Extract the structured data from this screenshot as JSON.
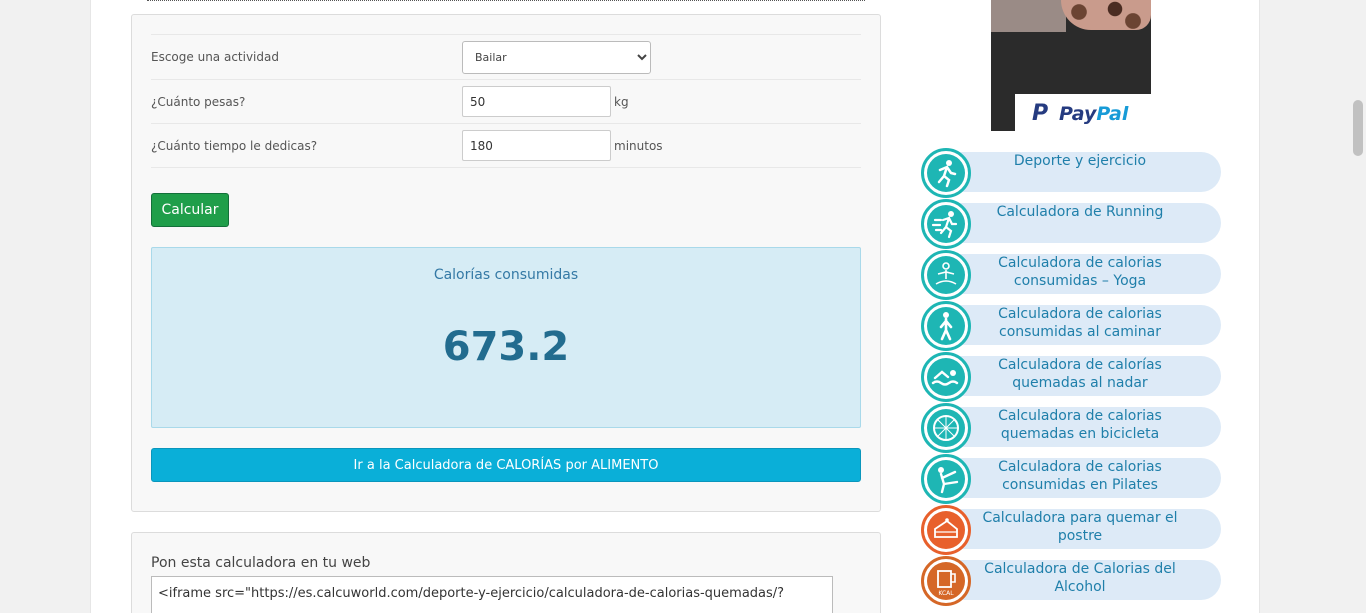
{
  "form": {
    "activity_label": "Escoge una actividad",
    "activity_value": "Bailar",
    "weight_label": "¿Cuánto pesas?",
    "weight_value": "50",
    "weight_unit": "kg",
    "time_label": "¿Cuánto tiempo le dedicas?",
    "time_value": "180",
    "time_unit": "minutos",
    "calc_button": "Calcular"
  },
  "result": {
    "title": "Calorías consumidas",
    "value": "673.2"
  },
  "food_button": "Ir a la Calculadora de CALORÍAS por ALIMENTO",
  "embed": {
    "title": "Pon esta calculadora en tu web",
    "code": "<iframe src=\"https://es.calcuworld.com/deporte-y-ejercicio/calculadora-de-calorias-quemadas/?"
  },
  "ad": {
    "brand_a": "Pay",
    "brand_b": "Pal"
  },
  "sidebar": {
    "links": [
      {
        "label": "Deporte y ejercicio",
        "icon": "runner-icon",
        "color": "#1eb6b4"
      },
      {
        "label": "Calculadora de Running",
        "icon": "running-fast-icon",
        "color": "#1eb6b4"
      },
      {
        "label": "Calculadora de calorias consumidas – Yoga",
        "icon": "yoga-icon",
        "color": "#1eb6b4"
      },
      {
        "label": "Calculadora de calorias consumidas al caminar",
        "icon": "walking-icon",
        "color": "#1eb6b4"
      },
      {
        "label": "Calculadora de calorías quemadas al nadar",
        "icon": "swimming-icon",
        "color": "#1eb6b4"
      },
      {
        "label": "Calculadora de calorias quemadas en bicicleta",
        "icon": "bicycle-wheel-icon",
        "color": "#1eb6b4"
      },
      {
        "label": "Calculadora de calorias consumidas en Pilates",
        "icon": "pilates-icon",
        "color": "#1eb6b4"
      },
      {
        "label": "Calculadora para quemar el postre",
        "icon": "cake-icon",
        "color": "#e8602c"
      },
      {
        "label": "Calculadora de Calorias del Alcohol",
        "icon": "beer-kcal-icon",
        "color": "#d56727"
      }
    ]
  }
}
